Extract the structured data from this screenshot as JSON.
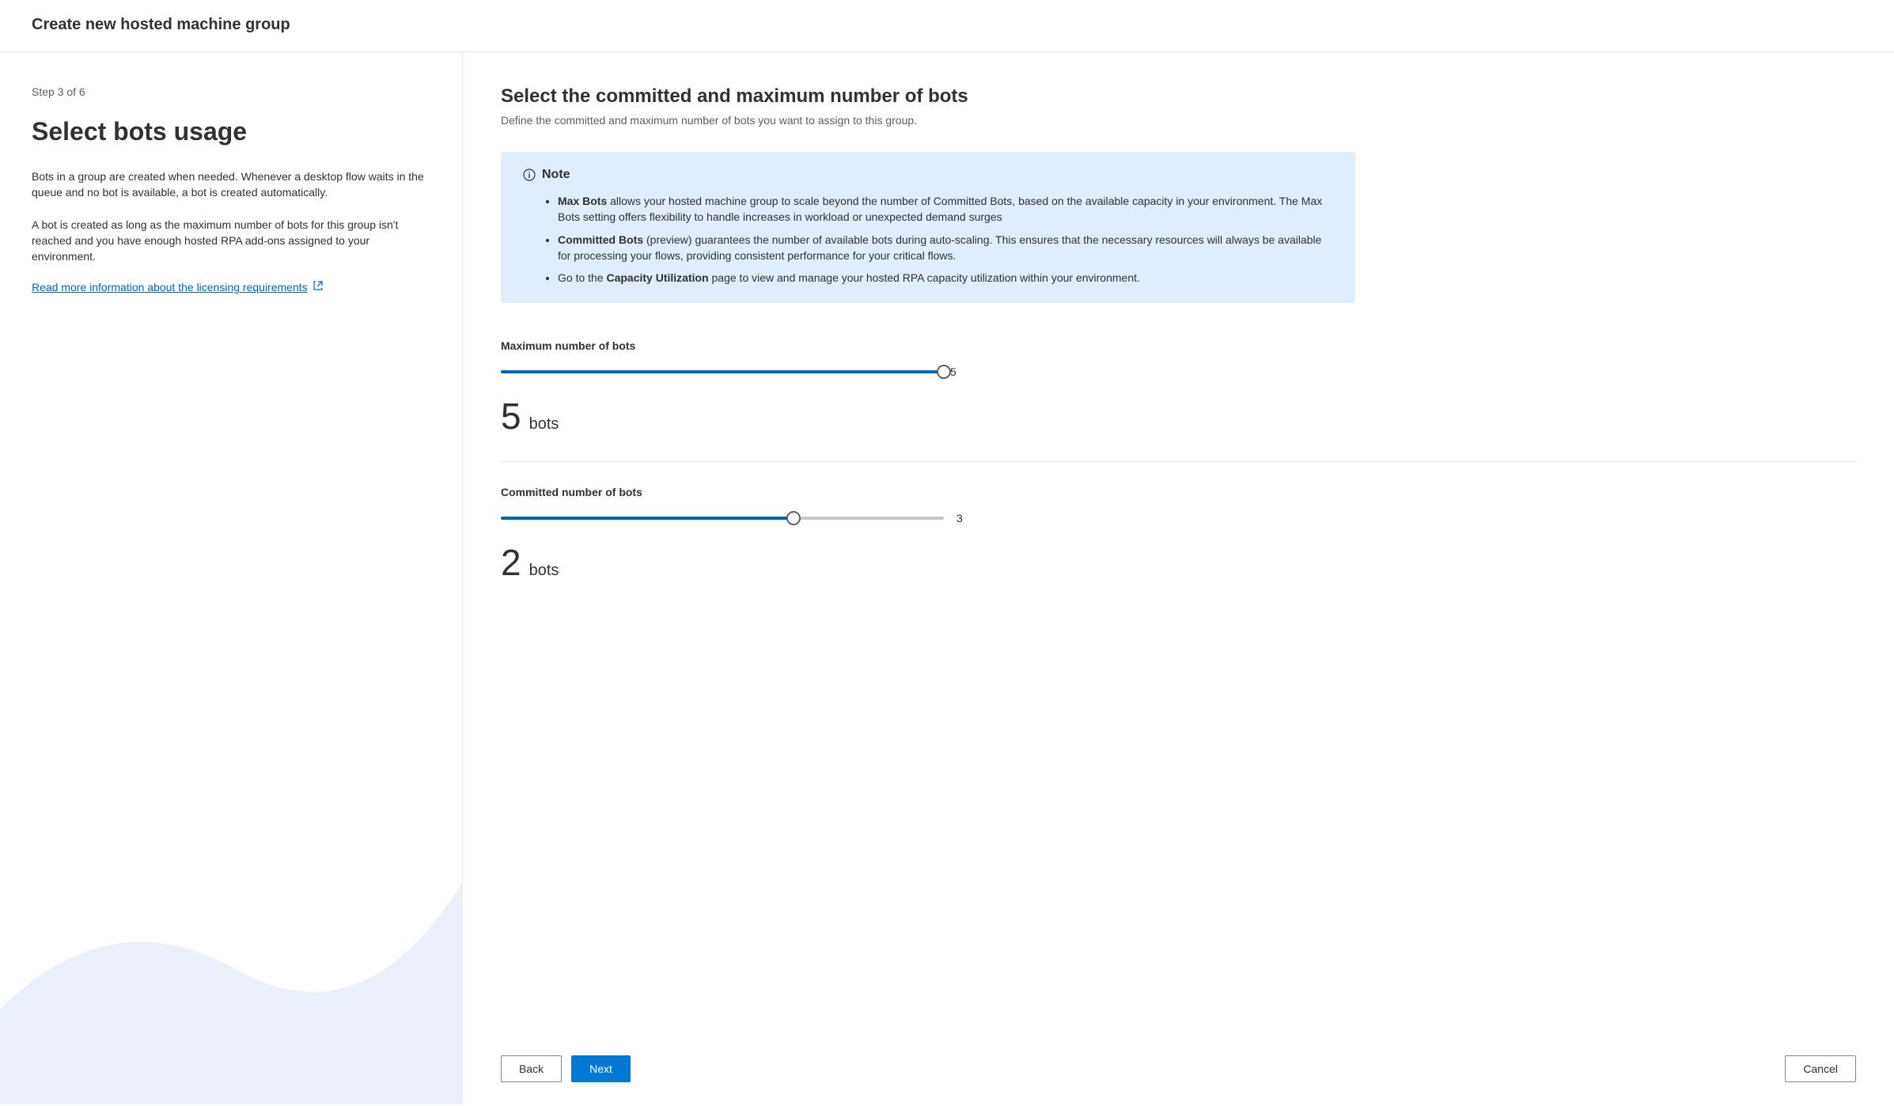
{
  "header": {
    "title": "Create new hosted machine group"
  },
  "sidebar": {
    "step": "Step 3 of 6",
    "title": "Select bots usage",
    "paragraph1": "Bots in a group are created when needed. Whenever a desktop flow waits in the queue and no bot is available, a bot is created automatically.",
    "paragraph2": "A bot is created as long as the maximum number of bots for this group isn't reached and you have enough hosted RPA add-ons assigned to your environment.",
    "link_text": "Read more information about the licensing requirements"
  },
  "main": {
    "title": "Select the committed and maximum number of bots",
    "subtitle": "Define the committed and maximum number of bots you want to assign to this group.",
    "note": {
      "label": "Note",
      "item1_strong": "Max Bots",
      "item1_text": " allows your hosted machine group to scale beyond the number of Committed Bots, based on the available capacity in your environment. The Max Bots setting offers flexibility to handle increases in workload or unexpected demand surges",
      "item2_strong": "Committed Bots",
      "item2_text": " (preview) guarantees the number of available bots during auto-scaling. This ensures that the necessary resources will always be available for processing your flows, providing consistent performance for your critical flows.",
      "item3_prefix": "Go to the ",
      "item3_strong": "Capacity Utilization",
      "item3_text": " page to view and manage your hosted RPA capacity utilization within your environment."
    },
    "max_bots": {
      "label": "Maximum number of bots",
      "value": "5",
      "max": "5",
      "unit": "bots"
    },
    "committed_bots": {
      "label": "Committed number of bots",
      "value": "2",
      "max": "3",
      "unit": "bots"
    }
  },
  "footer": {
    "back": "Back",
    "next": "Next",
    "cancel": "Cancel"
  }
}
